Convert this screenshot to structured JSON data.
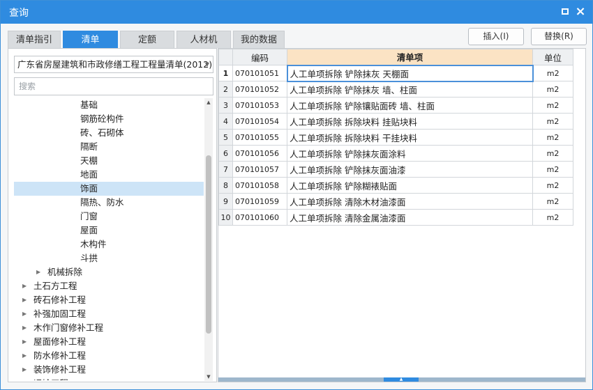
{
  "window": {
    "title": "查询"
  },
  "tabs": [
    {
      "label": "清单指引",
      "active": false
    },
    {
      "label": "清单",
      "active": true
    },
    {
      "label": "定额",
      "active": false
    },
    {
      "label": "人材机",
      "active": false
    },
    {
      "label": "我的数据",
      "active": false
    }
  ],
  "actions": {
    "insert_label": "插入(I)",
    "replace_label": "替换(R)"
  },
  "library": {
    "selected": "广东省房屋建筑和市政修缮工程工程量清单(2012)"
  },
  "search": {
    "placeholder": "搜索"
  },
  "tree": [
    {
      "label": "基础",
      "level": 3,
      "expandable": false,
      "selected": false
    },
    {
      "label": "钢筋砼构件",
      "level": 3,
      "expandable": false,
      "selected": false
    },
    {
      "label": "砖、石砌体",
      "level": 3,
      "expandable": false,
      "selected": false
    },
    {
      "label": "隔断",
      "level": 3,
      "expandable": false,
      "selected": false
    },
    {
      "label": "天棚",
      "level": 3,
      "expandable": false,
      "selected": false
    },
    {
      "label": "地面",
      "level": 3,
      "expandable": false,
      "selected": false
    },
    {
      "label": "饰面",
      "level": 3,
      "expandable": false,
      "selected": true
    },
    {
      "label": "隔热、防水",
      "level": 3,
      "expandable": false,
      "selected": false
    },
    {
      "label": "门窗",
      "level": 3,
      "expandable": false,
      "selected": false
    },
    {
      "label": "屋面",
      "level": 3,
      "expandable": false,
      "selected": false
    },
    {
      "label": "木构件",
      "level": 3,
      "expandable": false,
      "selected": false
    },
    {
      "label": "斗拱",
      "level": 3,
      "expandable": false,
      "selected": false
    },
    {
      "label": "机械拆除",
      "level": 2,
      "expandable": true,
      "selected": false
    },
    {
      "label": "土石方工程",
      "level": 1,
      "expandable": true,
      "selected": false
    },
    {
      "label": "砖石修补工程",
      "level": 1,
      "expandable": true,
      "selected": false
    },
    {
      "label": "补强加固工程",
      "level": 1,
      "expandable": true,
      "selected": false
    },
    {
      "label": "木作门窗修补工程",
      "level": 1,
      "expandable": true,
      "selected": false
    },
    {
      "label": "屋面修补工程",
      "level": 1,
      "expandable": true,
      "selected": false
    },
    {
      "label": "防水修补工程",
      "level": 1,
      "expandable": true,
      "selected": false
    },
    {
      "label": "装饰修补工程",
      "level": 1,
      "expandable": true,
      "selected": false
    },
    {
      "label": "运输工程",
      "level": 1,
      "expandable": true,
      "selected": false
    }
  ],
  "table": {
    "columns": [
      "编码",
      "清单项",
      "单位"
    ],
    "rows": [
      {
        "num": "1",
        "code": "070101051",
        "name": "人工单项拆除  铲除抹灰  天棚面",
        "unit": "m2"
      },
      {
        "num": "2",
        "code": "070101052",
        "name": "人工单项拆除  铲除抹灰  墙、柱面",
        "unit": "m2"
      },
      {
        "num": "3",
        "code": "070101053",
        "name": "人工单项拆除  铲除镶贴面砖  墙、柱面",
        "unit": "m2"
      },
      {
        "num": "4",
        "code": "070101054",
        "name": "人工单项拆除  拆除块料  挂贴块料",
        "unit": "m2"
      },
      {
        "num": "5",
        "code": "070101055",
        "name": "人工单项拆除  拆除块料  干挂块料",
        "unit": "m2"
      },
      {
        "num": "6",
        "code": "070101056",
        "name": "人工单项拆除  铲除抹灰面涂料",
        "unit": "m2"
      },
      {
        "num": "7",
        "code": "070101057",
        "name": "人工单项拆除  铲除抹灰面油漆",
        "unit": "m2"
      },
      {
        "num": "8",
        "code": "070101058",
        "name": "人工单项拆除  铲除糊裱贴面",
        "unit": "m2"
      },
      {
        "num": "9",
        "code": "070101059",
        "name": "人工单项拆除  清除木材油漆面",
        "unit": "m2"
      },
      {
        "num": "10",
        "code": "070101060",
        "name": "人工单项拆除  清除金属油漆面",
        "unit": "m2"
      }
    ],
    "current_row": 0
  },
  "colors": {
    "accent": "#2f8be0",
    "selected_tree": "#cde4f7",
    "header_highlight": "#fbe3c4"
  }
}
